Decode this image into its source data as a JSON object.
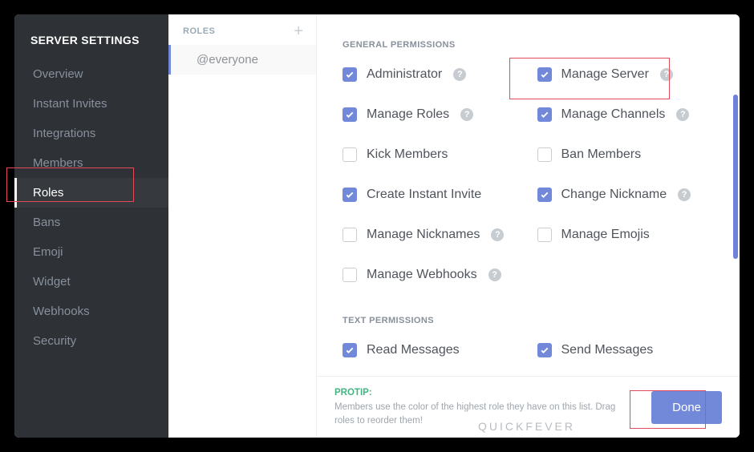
{
  "sidebar": {
    "title": "SERVER SETTINGS",
    "items": [
      {
        "label": "Overview",
        "active": false
      },
      {
        "label": "Instant Invites",
        "active": false
      },
      {
        "label": "Integrations",
        "active": false
      },
      {
        "label": "Members",
        "active": false
      },
      {
        "label": "Roles",
        "active": true
      },
      {
        "label": "Bans",
        "active": false
      },
      {
        "label": "Emoji",
        "active": false
      },
      {
        "label": "Widget",
        "active": false
      },
      {
        "label": "Webhooks",
        "active": false
      },
      {
        "label": "Security",
        "active": false
      }
    ]
  },
  "roles_col": {
    "header": "ROLES",
    "add_symbol": "+",
    "items": [
      {
        "label": "@everyone",
        "active": true
      }
    ]
  },
  "sections": {
    "general": {
      "title": "GENERAL PERMISSIONS",
      "perms": [
        {
          "label": "Administrator",
          "checked": true,
          "help": true
        },
        {
          "label": "Manage Server",
          "checked": true,
          "help": true
        },
        {
          "label": "Manage Roles",
          "checked": true,
          "help": true
        },
        {
          "label": "Manage Channels",
          "checked": true,
          "help": true
        },
        {
          "label": "Kick Members",
          "checked": false,
          "help": false
        },
        {
          "label": "Ban Members",
          "checked": false,
          "help": false
        },
        {
          "label": "Create Instant Invite",
          "checked": true,
          "help": false
        },
        {
          "label": "Change Nickname",
          "checked": true,
          "help": true
        },
        {
          "label": "Manage Nicknames",
          "checked": false,
          "help": true
        },
        {
          "label": "Manage Emojis",
          "checked": false,
          "help": false
        },
        {
          "label": "Manage Webhooks",
          "checked": false,
          "help": true
        }
      ]
    },
    "text": {
      "title": "TEXT PERMISSIONS",
      "perms": [
        {
          "label": "Read Messages",
          "checked": true,
          "help": false
        },
        {
          "label": "Send Messages",
          "checked": true,
          "help": false
        }
      ]
    }
  },
  "footer": {
    "protip_label": "PROTIP:",
    "protip_text": "Members use the color of the highest role they have on this list. Drag roles to reorder them!",
    "done_label": "Done"
  },
  "watermark": "QUICKFEVER",
  "help_glyph": "?"
}
